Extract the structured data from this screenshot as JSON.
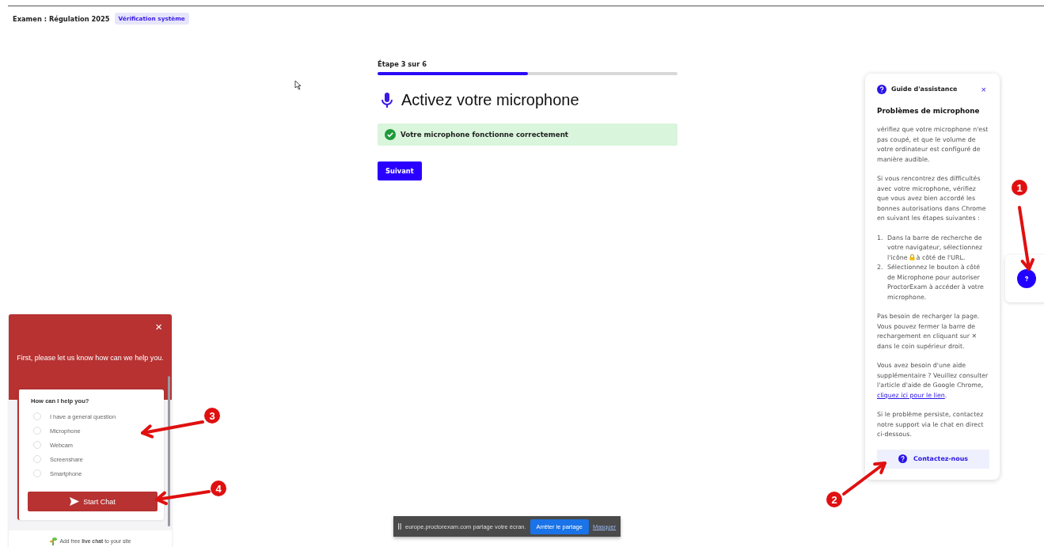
{
  "header": {
    "title": "Examen : Régulation 2025",
    "badge": "Vérification système"
  },
  "step": {
    "label": "Étape 3 sur 6",
    "level": 0.5
  },
  "heading": "Activez votre microphone",
  "status": {
    "kind": "success",
    "text": "Votre microphone fonctionne correctement"
  },
  "next_button": "Suivant",
  "guide": {
    "title": "Guide d'assistance",
    "close": "×",
    "heading": "Problèmes de microphone",
    "intro": [
      "vérifiez que votre microphone n'est pas coupé, et que le volume de votre ordinateur est configuré de manière audible.",
      "Si vous rencontrez des difficultés avec votre microphone, vérifiez que vous avez bien accordé les bonnes autorisations dans Chrome en suivant les étapes suivantes :"
    ],
    "steps": [
      {
        "marker": "1.",
        "before": "Dans la barre de recherche de votre navigateur, sélectionnez l'icône",
        "after": "à côté de l'URL."
      },
      {
        "marker": "2.",
        "before": "Sélectionnez le bouton à côté de Microphone pour autoriser ProctorExam à accéder à votre microphone."
      }
    ],
    "reload_note": "Pas besoin de recharger la page. Vous pouvez fermer la barre de rechargement en cliquant sur ✕ dans le coin supérieur droit.",
    "help_note": {
      "before": "Vous avez besoin d'une aide supplémentaire ? Veuillez consulter l'article d'aide de Google Chrome, ",
      "link": "cliquez ici pour le lien",
      "after": "."
    },
    "support_note": "Si le problème persiste, contactez notre support via le chat en direct ci-dessous.",
    "contact_button": "Contactez-nous"
  },
  "chat": {
    "close": "×",
    "intro": "First, please let us know how can we help you.",
    "question": "How can I help you?",
    "options": [
      {
        "label": "I have a general question",
        "selected": false
      },
      {
        "label": "Microphone",
        "selected": false
      },
      {
        "label": "Webcam",
        "selected": false
      },
      {
        "label": "Screenshare",
        "selected": false
      },
      {
        "label": "Smartphone",
        "selected": false
      }
    ],
    "start_button": "Start Chat",
    "footer": "Add free **live chat** to your site"
  },
  "share_bar": {
    "message": "europe.proctorexam.com partage votre écran.",
    "stop_button": "Arrêter le partage",
    "hide_link": "Masquer"
  },
  "annotations": [
    {
      "label": "1"
    },
    {
      "label": "2"
    },
    {
      "label": "3"
    },
    {
      "label": "4"
    }
  ]
}
